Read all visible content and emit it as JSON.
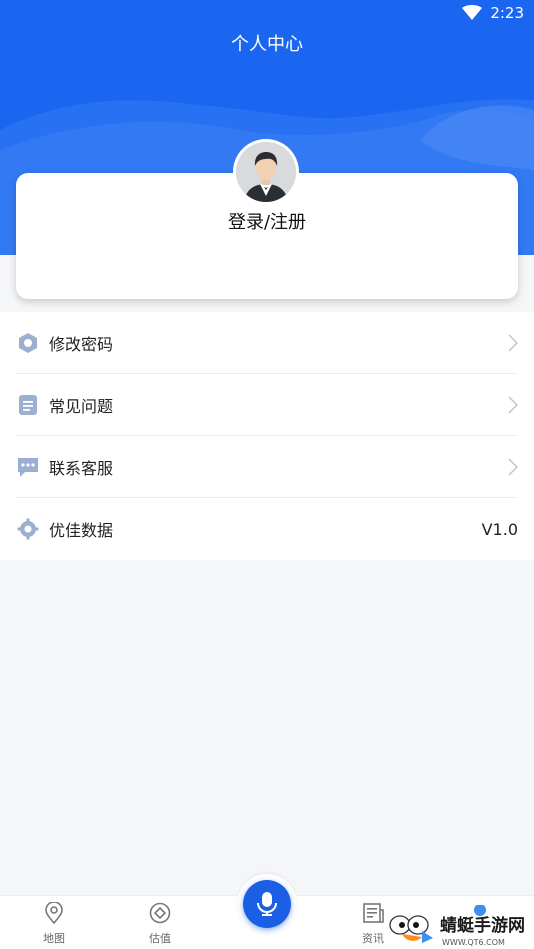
{
  "status_bar": {
    "time": "2:23",
    "wifi_icon": "wifi-icon"
  },
  "header": {
    "title": "个人中心",
    "background": "#1a66f0"
  },
  "profile": {
    "login_label": "登录/注册",
    "avatar_icon": "user-avatar"
  },
  "menu": {
    "items": [
      {
        "label": "修改密码",
        "icon": "hexagon-icon"
      },
      {
        "label": "常见问题",
        "icon": "document-icon"
      },
      {
        "label": "联系客服",
        "icon": "chat-icon"
      },
      {
        "label": "优佳数据",
        "icon": "gear-icon",
        "value": "V1.0"
      }
    ]
  },
  "tabbar": {
    "tabs": [
      {
        "label": "地图",
        "icon": "location-pin-icon"
      },
      {
        "label": "估值",
        "icon": "diamond-icon"
      },
      {
        "label": "",
        "icon": "microphone-icon"
      },
      {
        "label": "资讯",
        "icon": "news-icon"
      }
    ],
    "accent": "#1a5fe4"
  },
  "watermark": {
    "text": "蜻蜓手游网",
    "subtext": "WWW.QT6.COM"
  }
}
